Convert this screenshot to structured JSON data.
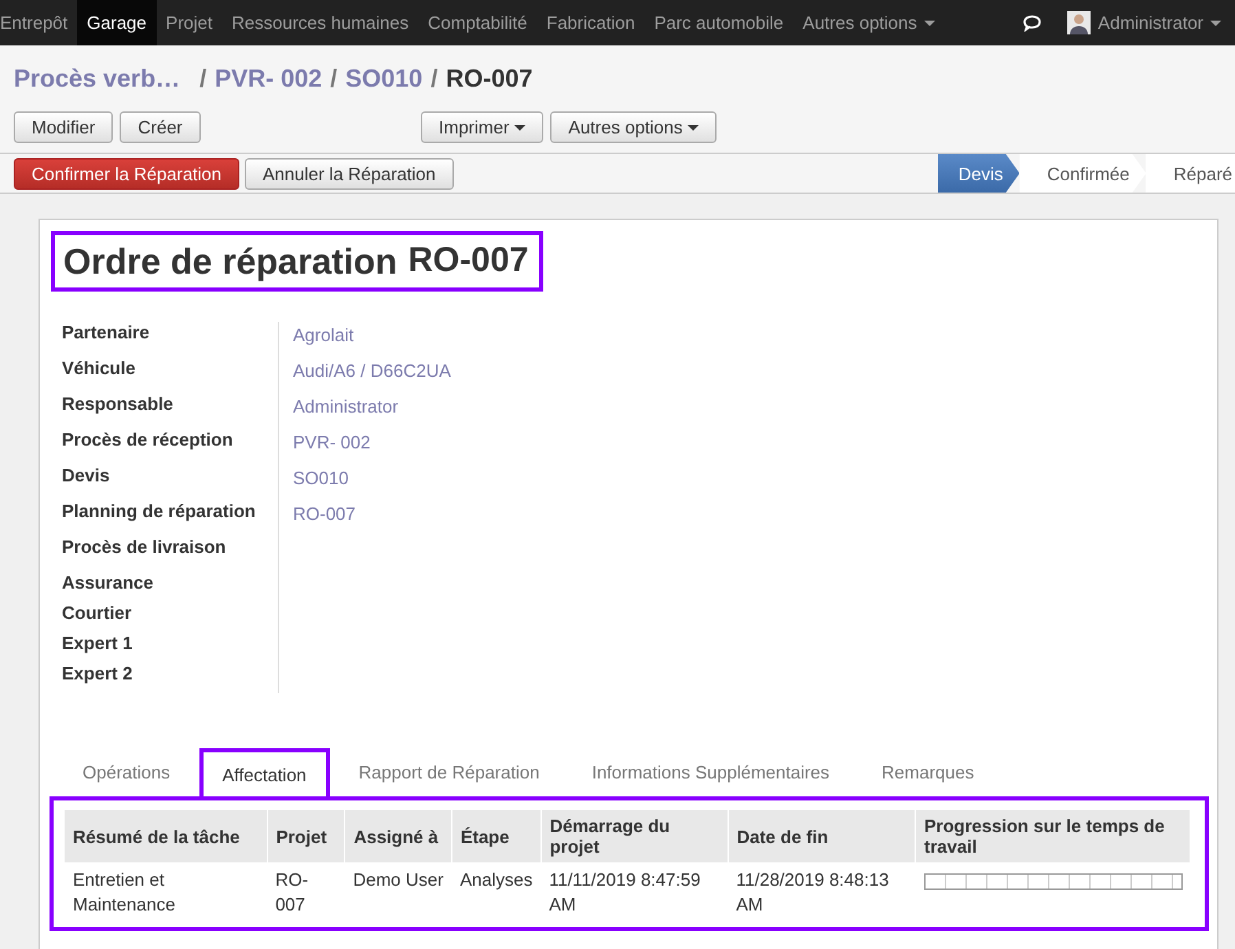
{
  "navbar": {
    "menu": [
      {
        "label": "Entrepôt",
        "selected": false
      },
      {
        "label": "Garage",
        "selected": true
      },
      {
        "label": "Projet",
        "selected": false
      },
      {
        "label": "Ressources humaines",
        "selected": false
      },
      {
        "label": "Comptabilité",
        "selected": false
      },
      {
        "label": "Fabrication",
        "selected": false
      },
      {
        "label": "Parc automobile",
        "selected": false
      },
      {
        "label": "Autres options",
        "selected": false,
        "dropdown": true
      }
    ],
    "user": "Administrator"
  },
  "breadcrumb": {
    "separator": "/",
    "items": [
      {
        "label": "Procès verb…",
        "current": false
      },
      {
        "label": "PVR- 002",
        "current": false
      },
      {
        "label": "SO010",
        "current": false
      },
      {
        "label": "RO-007",
        "current": true
      }
    ]
  },
  "toolbar": {
    "left": [
      "Modifier",
      "Créer"
    ],
    "center": [
      {
        "label": "Imprimer",
        "dropdown": true
      },
      {
        "label": "Autres options",
        "dropdown": true
      }
    ]
  },
  "statusbar": {
    "buttons": [
      {
        "label": "Confirmer la Réparation",
        "kind": "primary"
      },
      {
        "label": "Annuler la Réparation",
        "kind": "default"
      }
    ],
    "stages": [
      {
        "label": "Devis",
        "selected": true
      },
      {
        "label": "Confirmée",
        "selected": false
      },
      {
        "label": "Réparé",
        "selected": false
      }
    ]
  },
  "form": {
    "title": "Ordre de réparation",
    "reference": "RO-007",
    "fields": [
      {
        "label": "Partenaire",
        "value": "Agrolait"
      },
      {
        "label": "Véhicule",
        "value": "Audi/A6 / D66C2UA"
      },
      {
        "label": "Responsable",
        "value": "Administrator"
      },
      {
        "label": "Procès de réception",
        "value": "PVR- 002"
      },
      {
        "label": "Devis",
        "value": "SO010"
      },
      {
        "label": "Planning de réparation",
        "value": "RO-007"
      },
      {
        "label": "Procès de livraison"
      },
      {
        "label": "Assurance"
      },
      {
        "label": "Courtier"
      },
      {
        "label": "Expert 1"
      },
      {
        "label": "Expert 2"
      }
    ],
    "tabs": [
      {
        "label": "Opérations",
        "selected": false
      },
      {
        "label": "Affectation",
        "selected": true
      },
      {
        "label": "Rapport de Réparation",
        "selected": false
      },
      {
        "label": "Informations Supplémentaires",
        "selected": false
      },
      {
        "label": "Remarques",
        "selected": false
      }
    ],
    "table": {
      "columns": [
        "Résumé de la tâche",
        "Projet",
        "Assigné à",
        "Étape",
        "Démarrage du projet",
        "Date de fin",
        "Progression sur le temps de travail"
      ],
      "rows": [
        {
          "cells": [
            "Entretien et Maintenance",
            "RO-007",
            "Demo User",
            "Analyses",
            "11/11/2019 8:47:59 AM",
            "11/28/2019 8:48:13 AM"
          ],
          "level": 0
        }
      ]
    }
  }
}
